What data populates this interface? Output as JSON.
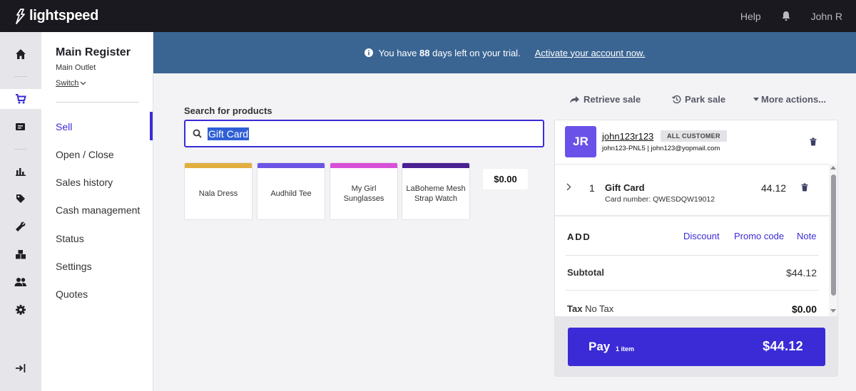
{
  "topbar": {
    "brand": "lightspeed",
    "help": "Help",
    "user": "John R",
    "icons": [
      "lightspeed-flame-icon",
      "bell-icon"
    ]
  },
  "rail": {
    "icons": [
      "home-icon",
      "cart-icon",
      "register-icon",
      "reports-icon",
      "tag-icon",
      "wrench-icon",
      "boxes-icon",
      "customers-icon",
      "gear-icon",
      "collapse-icon"
    ]
  },
  "register": {
    "title": "Main Register",
    "outlet": "Main Outlet",
    "switch": "Switch",
    "nav": [
      "Sell",
      "Open / Close",
      "Sales history",
      "Cash management",
      "Status",
      "Settings",
      "Quotes"
    ],
    "active": "Sell"
  },
  "banner": {
    "text_before": "You have",
    "days": "88",
    "text_after": "days left on your trial.",
    "link": "Activate your account now."
  },
  "search": {
    "label": "Search for products",
    "value": "Gift Card"
  },
  "products": [
    {
      "name": "Nala Dress",
      "color": "#e2ae40"
    },
    {
      "name": "Audhild Tee",
      "color": "#6a56e2"
    },
    {
      "name": "My Girl Sunglasses",
      "color": "#d84fd8"
    },
    {
      "name": "LaBoheme Mesh Strap Watch",
      "color": "#4a2192"
    }
  ],
  "price_chip": "$0.00",
  "actions": {
    "retrieve": "Retrieve sale",
    "park": "Park sale",
    "more": "More actions..."
  },
  "customer": {
    "initials": "JR",
    "name": "john123r123",
    "badge": "ALL CUSTOMER",
    "meta": "john123-PNL5 | john123@yopmail.com"
  },
  "line_item": {
    "qty": "1",
    "name": "Gift Card",
    "card": "Card number: QWESDQW19012",
    "price": "44.12"
  },
  "add": {
    "label": "ADD",
    "discount": "Discount",
    "promo": "Promo code",
    "note": "Note"
  },
  "totals": {
    "subtotal_label": "Subtotal",
    "subtotal_value": "$44.12",
    "tax_label": "Tax",
    "tax_detail": "No Tax",
    "tax_value": "$0.00"
  },
  "pay": {
    "label": "Pay",
    "items": "1 item",
    "total": "$44.12"
  },
  "colors": {
    "accent": "#3a2bd6",
    "banner": "#3a6593",
    "topbar": "#19191f"
  }
}
